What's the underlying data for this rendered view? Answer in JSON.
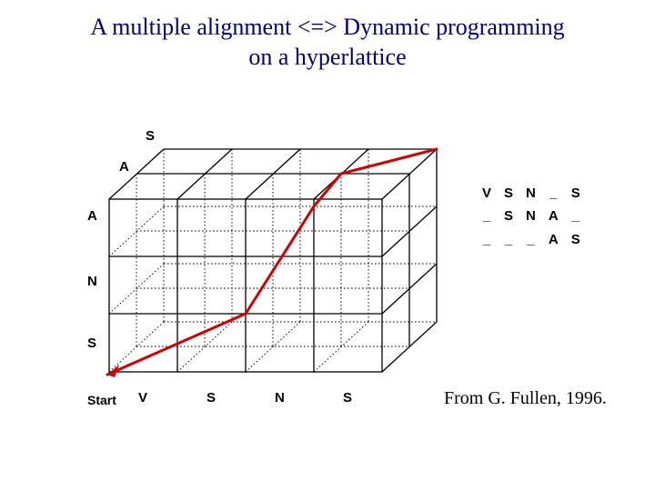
{
  "title_line1": "A multiple alignment <=> Dynamic programming",
  "title_line2": "on a hyperlattice",
  "axes": {
    "z_top": "S",
    "z_bot": "A",
    "y0": "A",
    "y1": "N",
    "y2": "S",
    "x0": "V",
    "x1": "S",
    "x2": "N",
    "x3": "S"
  },
  "start": "Start",
  "alignment": {
    "r0": [
      "V",
      "S",
      "N",
      "_",
      "S"
    ],
    "r1": [
      "_",
      "S",
      "N",
      "A",
      "_"
    ],
    "r2": [
      "_",
      "_",
      "_",
      "A",
      "S"
    ]
  },
  "citation": "From G. Fullen, 1996."
}
